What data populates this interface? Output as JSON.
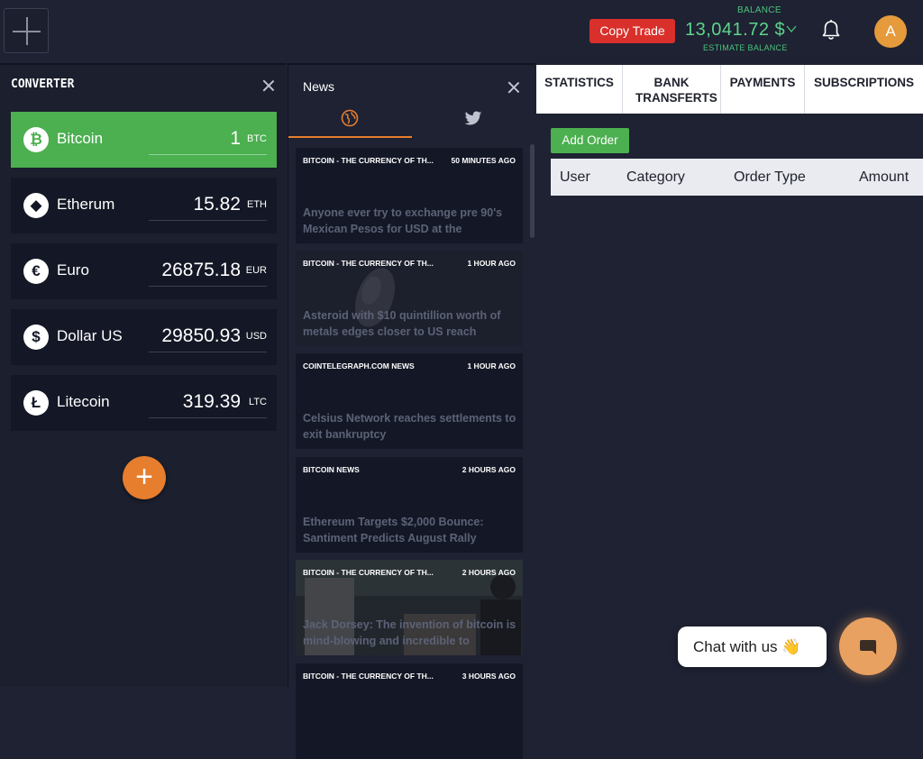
{
  "topbar": {
    "copy_trade_label": "Copy Trade",
    "balance_label": "BALANCE",
    "balance_value": "13,041.72 $",
    "estimate_label": "ESTIMATE BALANCE",
    "avatar_initial": "A"
  },
  "converter": {
    "title": "CONVERTER",
    "coins": [
      {
        "name": "Bitcoin",
        "amount": "1",
        "unit": "BTC",
        "symbol": "₿"
      },
      {
        "name": "Etherum",
        "amount": "15.82",
        "unit": "ETH",
        "symbol": "◆"
      },
      {
        "name": "Euro",
        "amount": "26875.18",
        "unit": "EUR",
        "symbol": "€"
      },
      {
        "name": "Dollar US",
        "amount": "29850.93",
        "unit": "USD",
        "symbol": "$"
      },
      {
        "name": "Litecoin",
        "amount": "319.39",
        "unit": "LTC",
        "symbol": "Ł"
      }
    ],
    "add_label": "+"
  },
  "news": {
    "title": "News",
    "tabs": [
      "globe-icon",
      "twitter-icon"
    ],
    "items": [
      {
        "source": "BITCOIN - THE CURRENCY OF TH...",
        "time": "50 MINUTES AGO",
        "text": "Anyone ever try to exchange pre 90's Mexican Pesos for USD at the"
      },
      {
        "source": "BITCOIN - THE CURRENCY OF TH...",
        "time": "1 HOUR AGO",
        "text": "Asteroid with $10 quintillion worth of metals edges closer to US reach"
      },
      {
        "source": "COINTELEGRAPH.COM NEWS",
        "time": "1 HOUR AGO",
        "text": "Celsius Network reaches settlements to exit bankruptcy"
      },
      {
        "source": "BITCOIN NEWS",
        "time": "2 HOURS AGO",
        "text": "Ethereum Targets $2,000 Bounce: Santiment Predicts August Rally"
      },
      {
        "source": "BITCOIN - THE CURRENCY OF TH...",
        "time": "2 HOURS AGO",
        "text": "Jack Dorsey: The invention of bitcoin is mind-blowing and incredible to"
      },
      {
        "source": "BITCOIN - THE CURRENCY OF TH...",
        "time": "3 HOURS AGO",
        "text": ""
      }
    ]
  },
  "orders": {
    "tabs": [
      "STATISTICS",
      "BANK TRANSFERTS",
      "PAYMENTS",
      "SUBSCRIPTIONS"
    ],
    "add_order_label": "Add Order",
    "columns": [
      "User",
      "Category",
      "Order Type",
      "Amount"
    ]
  },
  "chat": {
    "label": "Chat with us 👋"
  },
  "colors": {
    "accent_green": "#4caf50",
    "accent_orange": "#e67e2e",
    "danger_red": "#d9302b",
    "background": "#1e2233"
  }
}
